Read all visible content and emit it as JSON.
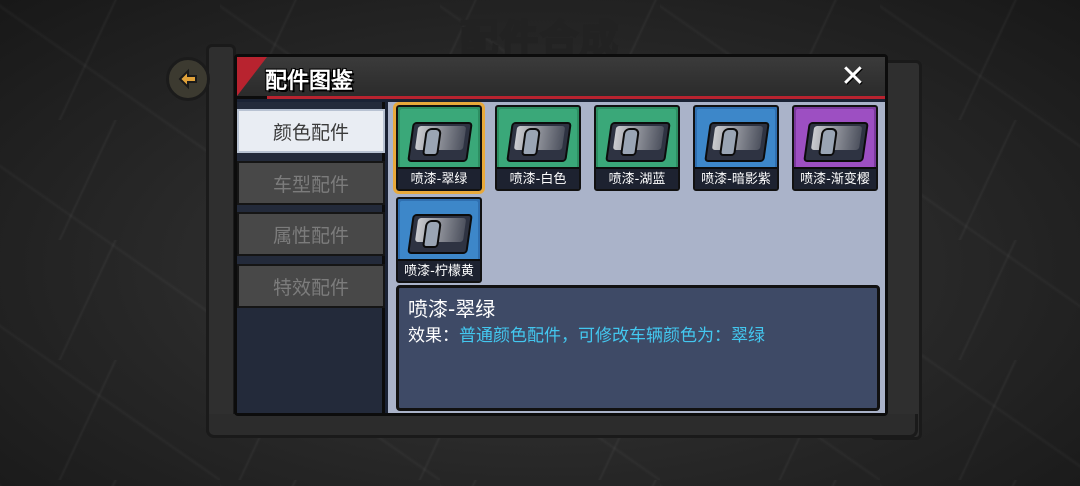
{
  "background": {
    "title": "配件合成"
  },
  "dialog": {
    "title": "配件图鉴",
    "close_label": "✕"
  },
  "sidebar": {
    "tabs": [
      {
        "label": "颜色配件",
        "active": true
      },
      {
        "label": "车型配件",
        "active": false
      },
      {
        "label": "属性配件",
        "active": false
      },
      {
        "label": "特效配件",
        "active": false
      }
    ]
  },
  "items": [
    {
      "label": "喷漆-翠绿",
      "frame": "#2d8f62",
      "art": "#3aa879",
      "selected": true
    },
    {
      "label": "喷漆-白色",
      "frame": "#2d8f62",
      "art": "#3aa879",
      "selected": false
    },
    {
      "label": "喷漆-湖蓝",
      "frame": "#2d8f62",
      "art": "#3aa879",
      "selected": false
    },
    {
      "label": "喷漆-暗影紫",
      "frame": "#2f6fb0",
      "art": "#3d87c9",
      "selected": false
    },
    {
      "label": "喷漆-渐变樱",
      "frame": "#7a3a9c",
      "art": "#9d4fc2",
      "selected": false
    },
    {
      "label": "喷漆-柠檬黄",
      "frame": "#2f6fb0",
      "art": "#3d87c9",
      "selected": false
    }
  ],
  "info": {
    "title": "喷漆-翠绿",
    "effect_key": "效果：",
    "effect_value": "普通颜色配件，可修改车辆颜色为：翠绿"
  }
}
